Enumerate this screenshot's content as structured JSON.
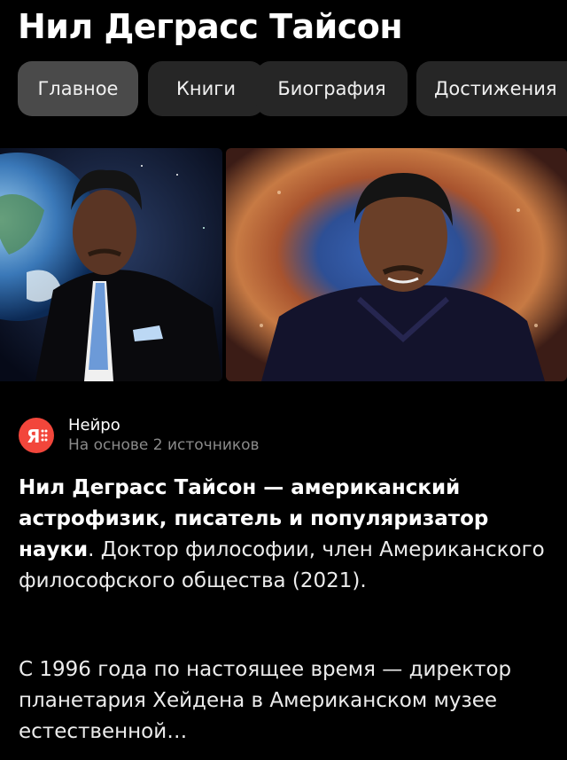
{
  "page": {
    "title": "Нил Деграсс Тайсон"
  },
  "tabs": [
    {
      "label": "Главное",
      "active": true
    },
    {
      "label": "Книги",
      "active": false
    },
    {
      "label": "Биография",
      "active": false
    },
    {
      "label": "Достижения",
      "active": false
    }
  ],
  "source": {
    "icon": "yandex-neuro-logo",
    "brand_color": "#f2463b",
    "name": "Нейро",
    "subtitle": "На основе 2 источников"
  },
  "answer": {
    "p1_bold": "Нил Деграсс Тайсон — американский астрофизик, писатель и популяризатор науки",
    "p1_rest": ". Доктор философии, член Американского философского общества (2021).",
    "p2": "С 1996 года по настоящее время — директор планетария Хейдена в Американском музее естественной…"
  }
}
